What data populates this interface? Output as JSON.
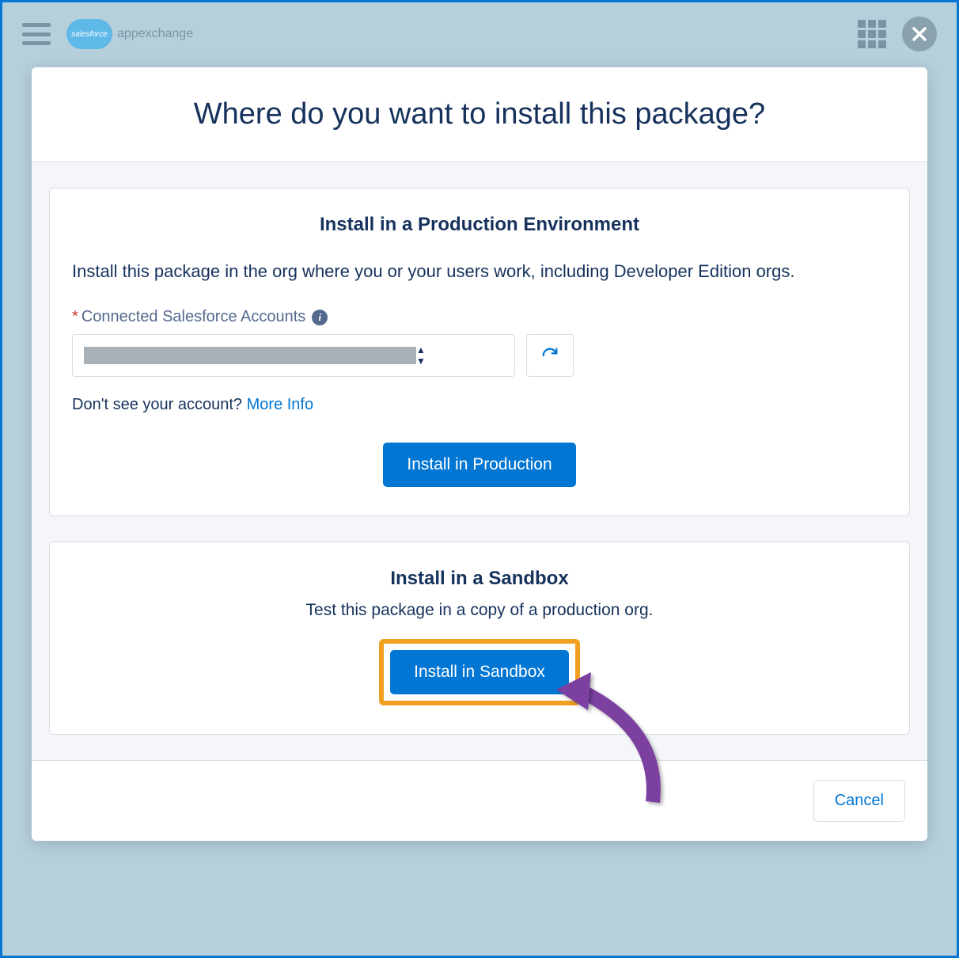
{
  "header": {
    "brand": "salesforce",
    "brand_suffix": "appexchange"
  },
  "modal": {
    "title": "Where do you want to install this package?",
    "production": {
      "title": "Install in a Production Environment",
      "description": "Install this package in the org where you or your users work, including Developer Edition orgs.",
      "field_label": "Connected Salesforce Accounts",
      "help_prefix": "Don't see your account? ",
      "help_link": "More Info",
      "button": "Install in Production"
    },
    "sandbox": {
      "title": "Install in a Sandbox",
      "description": "Test this package in a copy of a production org.",
      "button": "Install in Sandbox"
    },
    "footer": {
      "cancel": "Cancel"
    }
  }
}
